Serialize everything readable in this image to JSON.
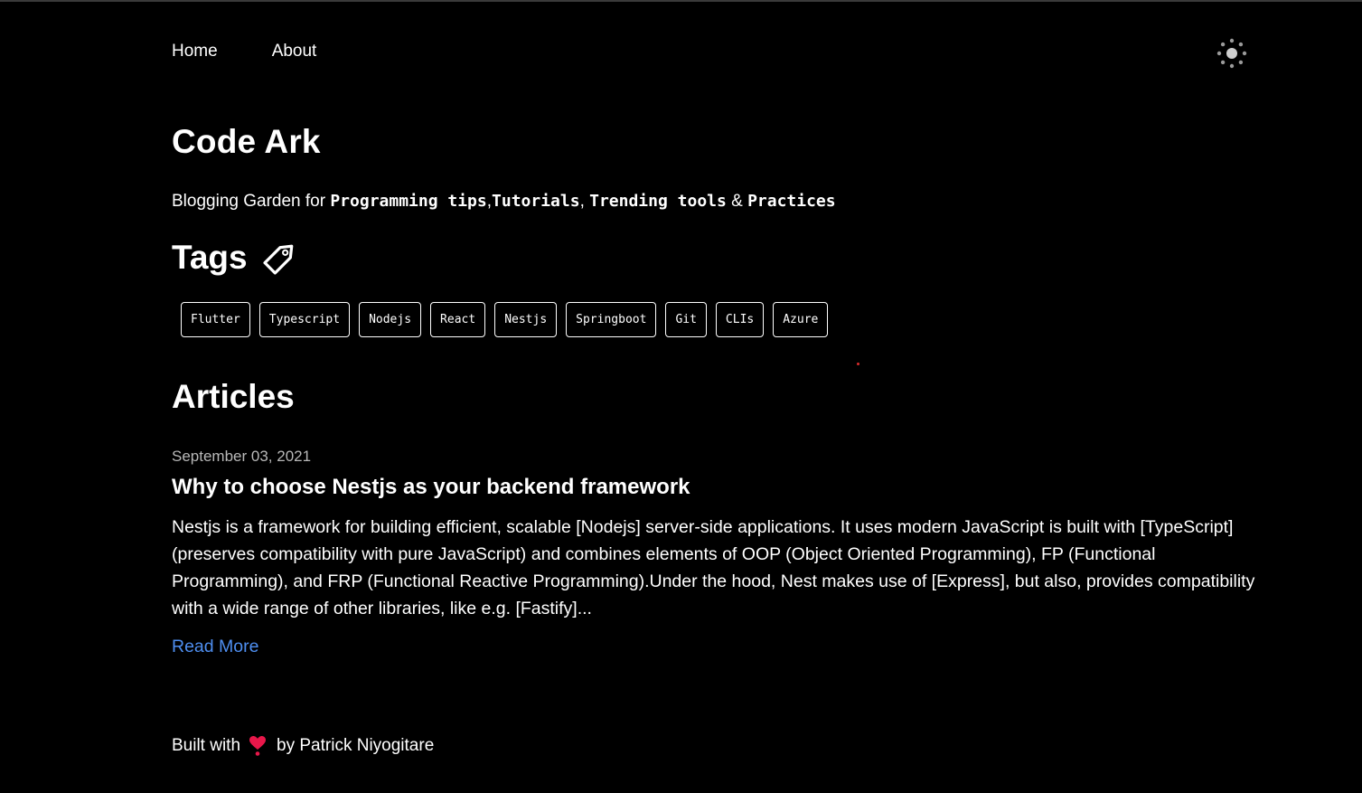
{
  "nav": {
    "home_label": "Home",
    "about_label": "About"
  },
  "site": {
    "title": "Code Ark",
    "tagline_prefix": "Blogging Garden for ",
    "tagline_code1": "Programming tips",
    "tagline_sep1": ",",
    "tagline_code2": "Tutorials",
    "tagline_sep2": ", ",
    "tagline_code3": "Trending tools",
    "tagline_sep3": " & ",
    "tagline_code4": "Practices"
  },
  "tags": {
    "heading": "Tags",
    "items": [
      "Flutter",
      "Typescript",
      "Nodejs",
      "React",
      "Nestjs",
      "Springboot",
      "Git",
      "CLIs",
      "Azure"
    ]
  },
  "articles": {
    "heading": "Articles",
    "items": [
      {
        "date": "September 03, 2021",
        "title": "Why to choose Nestjs as your backend framework",
        "excerpt": "Nestjs is a framework for building efficient, scalable [Nodejs] server-side applications. It uses modern JavaScript is built with [TypeScript] (preserves compatibility with pure JavaScript) and combines elements of OOP (Object Oriented Programming), FP (Functional Programming), and FRP (Functional Reactive Programming).Under the hood, Nest makes use of [Express], but also, provides compatibility with a wide range of other libraries, like e.g. [Fastify]...",
        "read_more": "Read More"
      }
    ]
  },
  "footer": {
    "prefix": "Built with",
    "suffix": "by Patrick Niyogitare"
  },
  "icons": {
    "theme_toggle": "sun-icon",
    "tags": "tag-icon",
    "footer": "heart-icon"
  },
  "colors": {
    "background": "#000000",
    "text": "#ffffff",
    "link": "#4e8ef0",
    "date": "#b8b8b8",
    "heart": "#e8174a"
  }
}
